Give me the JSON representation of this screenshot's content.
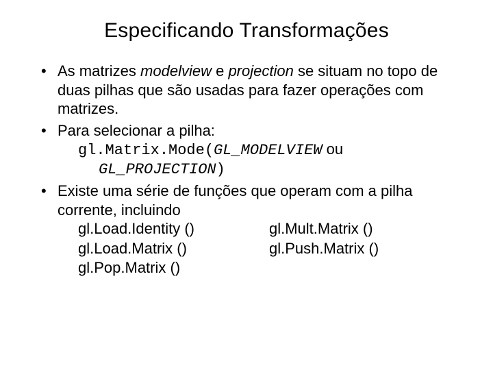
{
  "title": "Especificando Transformações",
  "bullets": {
    "b1_pre": "As matrizes ",
    "b1_it1": "modelview",
    "b1_mid": " e ",
    "b1_it2": "projection",
    "b1_post": " se situam no topo de duas pilhas que são usadas para fazer operações com matrizes.",
    "b2": "Para selecionar a pilha:",
    "b2_code_line1_a": "gl.Matrix.Mode(",
    "b2_code_line1_b": "GL_MODELVIEW",
    "b2_code_line1_tail": " ou",
    "b2_code_line2_a": "GL_PROJECTION",
    "b2_code_line2_b": ")",
    "b3": "Existe uma série de funções que operam com a pilha corrente, incluindo",
    "fn_left": [
      "gl.Load.Identity ()",
      "gl.Load.Matrix ()",
      "gl.Pop.Matrix ()"
    ],
    "fn_right": [
      "gl.Mult.Matrix ()",
      "gl.Push.Matrix ()"
    ]
  }
}
